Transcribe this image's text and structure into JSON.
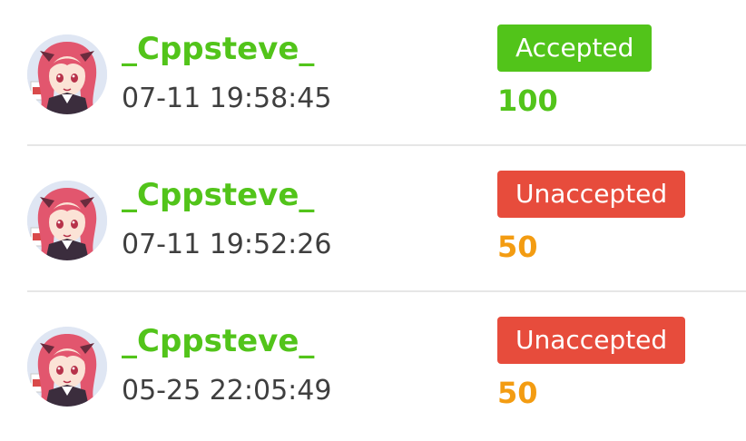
{
  "colors": {
    "username": "#52c41a",
    "accepted": "#52c41a",
    "unaccepted": "#e74c3c",
    "score_full": "#52c41a",
    "score_partial": "#f39c12",
    "time": "#3f3f3f"
  },
  "records": [
    {
      "avatar_icon": "anime-girl-avatar",
      "username": "_Cppsteve_",
      "time": "07-11 19:58:45",
      "status": "Accepted",
      "score": "100"
    },
    {
      "avatar_icon": "anime-girl-avatar",
      "username": "_Cppsteve_",
      "time": "07-11 19:52:26",
      "status": "Unaccepted",
      "score": "50"
    },
    {
      "avatar_icon": "anime-girl-avatar",
      "username": "_Cppsteve_",
      "time": "05-25 22:05:49",
      "status": "Unaccepted",
      "score": "50"
    }
  ]
}
